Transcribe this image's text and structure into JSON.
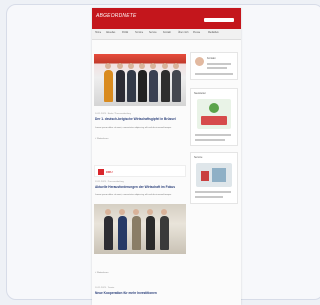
{
  "site": {
    "logo_text": "ABGEORDNETE",
    "nav_items": [
      "Home",
      "Aktuelles",
      "Politik",
      "Termine",
      "Service",
      "Kontakt",
      "Über mich",
      "Presse",
      "Mediathek"
    ],
    "search_placeholder": ""
  },
  "articles": [
    {
      "meta": "14.11.2023 · Rede / Pressemitteilung",
      "headline": "Der 1. deutsch-belgische Wirtschaftsgipfel in Brüssel",
      "excerpt": "Lorem ipsum dolor sit amet, consectetur adipiscing elit sed do eiusmod tempor.",
      "more": "» Weiterlesen"
    },
    {
      "meta": "13.11.2023 · Pressemitteilung",
      "headline": "Aktuelle Herausforderungen der Wirtschaft im Fokus",
      "excerpt": "Lorem ipsum dolor sit amet, consectetur adipiscing elit sed do eiusmod tempor.",
      "more": "» Weiterlesen",
      "banner_label": "CDU"
    },
    {
      "meta": "10.11.2023 · Termin",
      "headline": "Neue Kooperation für mehr Investitionen",
      "excerpt": "",
      "more": "» Weiterlesen"
    }
  ],
  "sidebar": {
    "profile_caption": "Kontakt",
    "box2_caption": "Newsletter",
    "box3_caption": "Service"
  },
  "colors": {
    "brand_red": "#c4161c",
    "headline_blue": "#2a3f7a"
  }
}
